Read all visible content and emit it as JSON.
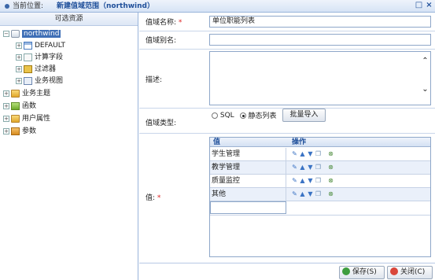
{
  "titlebar": {
    "location_label": "当前位置:",
    "breadcrumb": "新建值域范围（northwind）",
    "restore_glyph": "□",
    "close_glyph": "×"
  },
  "tree": {
    "header": "可选资源",
    "items": [
      {
        "label": "northwind",
        "icon": "database-icon",
        "expander": "−"
      },
      {
        "label": "DEFAULT",
        "icon": "table-icon",
        "expander": "+"
      },
      {
        "label": "计算字段",
        "icon": "calculator-icon",
        "expander": "+"
      },
      {
        "label": "过滤器",
        "icon": "filter-icon",
        "expander": "+"
      },
      {
        "label": "业务视图",
        "icon": "view-icon",
        "expander": "+"
      },
      {
        "label": "业务主题",
        "icon": "folder-icon",
        "expander": "+"
      },
      {
        "label": "函数",
        "icon": "function-icon",
        "expander": "+"
      },
      {
        "label": "用户属性",
        "icon": "user-attribute-icon",
        "expander": "+"
      },
      {
        "label": "参数",
        "icon": "parameter-icon",
        "expander": "+"
      }
    ]
  },
  "form": {
    "name_label": "值域名称:",
    "name_required": "*",
    "name_value": "单位职能列表",
    "alias_label": "值域别名:",
    "alias_value": "",
    "desc_label": "描述:",
    "desc_value": "",
    "type_label": "值域类型:",
    "type_options": [
      "SQL",
      "静态列表"
    ],
    "type_selected": "静态列表",
    "import_button": "批量导入",
    "values_label": "值:",
    "values_required": "*"
  },
  "grid": {
    "columns": [
      "值",
      "操作"
    ],
    "rows": [
      "学生管理",
      "教学管理",
      "质量监控",
      "其他"
    ]
  },
  "footer": {
    "save_button": "保存(S)",
    "close_button": "关闭(C)"
  },
  "colors": {
    "accent": "#1f4f9a",
    "selection": "#3f6fb6",
    "border": "#8ea7c9",
    "required": "#dd2222"
  }
}
